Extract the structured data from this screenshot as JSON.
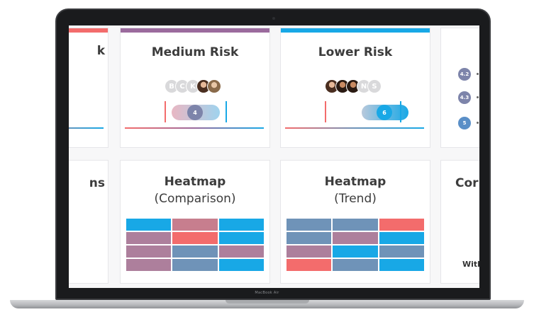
{
  "device": {
    "label": "MacBook Air"
  },
  "colors": {
    "coral": "#f36c6c",
    "purple": "#9b6b9d",
    "blue": "#18a8e6",
    "steel": "#6f93b8",
    "mauve": "#ad7f9c",
    "rose": "#c77e8e"
  },
  "cards": {
    "left_partial_top": {
      "title_fragment": "k"
    },
    "medium_risk": {
      "title": "Medium Risk",
      "avatars": [
        "B",
        "C",
        "K"
      ],
      "score": "4"
    },
    "lower_risk": {
      "title": "Lower Risk",
      "avatars": [
        "N",
        "S"
      ],
      "score": "6"
    },
    "right_partial_top": {
      "scores": [
        "4.2",
        "4.3",
        "5"
      ]
    },
    "left_partial_bottom": {
      "title_fragment": "ns"
    },
    "heatmap_comparison": {
      "title": "Heatmap",
      "subtitle": "(Comparison)",
      "cells": [
        [
          "#18a8e6",
          "#c77e8e",
          "#18a8e6"
        ],
        [
          "#ad7f9c",
          "#f36c6c",
          "#18a8e6"
        ],
        [
          "#ad7f9c",
          "#6f93b8",
          "#ad7f9c"
        ],
        [
          "#ad7f9c",
          "#6f93b8",
          "#18a8e6"
        ]
      ]
    },
    "heatmap_trend": {
      "title": "Heatmap",
      "subtitle": "(Trend)",
      "cells": [
        [
          "#6f93b8",
          "#6f93b8",
          "#f36c6c"
        ],
        [
          "#6f93b8",
          "#ad7f9c",
          "#18a8e6"
        ],
        [
          "#ad7f9c",
          "#18a8e6",
          "#6f93b8"
        ],
        [
          "#f36c6c",
          "#6f93b8",
          "#18a8e6"
        ]
      ]
    },
    "right_partial_bottom": {
      "title_fragment": "Cor",
      "footer_fragment": "With"
    }
  }
}
